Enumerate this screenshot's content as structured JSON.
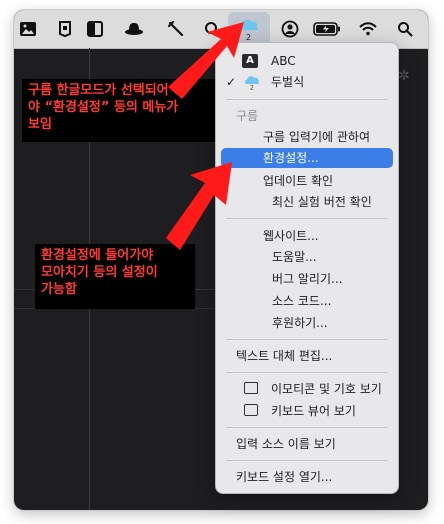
{
  "menubar": {
    "icons": [
      "photos-icon",
      "app-icon",
      "sidebar-icon",
      "hat-icon",
      "tools-icon",
      "search-icon",
      "gureum-input-icon",
      "user-icon",
      "battery-icon",
      "wifi-icon",
      "spotlight-icon"
    ],
    "gureum_icon_label": "2"
  },
  "menu": {
    "abc_badge": "A",
    "abc_label": "ABC",
    "dubeolsik_label": "두벌식",
    "checkmark": "✓",
    "section_header": "구름",
    "about": "구름 입력기에 관하여",
    "preferences": "환경설정...",
    "update_check": "업데이트 확인",
    "beta_check": "최신 실험 버전 확인",
    "website": "웹사이트...",
    "help": "도움말...",
    "bug_report": "버그 알리기...",
    "source_code": "소스 코드...",
    "donate": "후원하기...",
    "text_replacements": "텍스트 대체 편집...",
    "emoji_symbols": "이모티콘 및 기호 보기",
    "keyboard_viewer": "키보드 뷰어 보기",
    "input_source_name": "입력 소스 이름 보기",
    "keyboard_settings": "키보드 설정 열기..."
  },
  "callouts": {
    "top": [
      "구름 한글모드가 선택되어",
      "야 “환경설정” 등의 메뉴가",
      "보임"
    ],
    "bottom": [
      "환경설정에 들어가야",
      "모아치기 등의 설정이",
      "가능함"
    ]
  },
  "colors": {
    "highlight": "#3b7ee8",
    "callout_text": "#ff3b30",
    "arrow": "#ff1a1a"
  }
}
